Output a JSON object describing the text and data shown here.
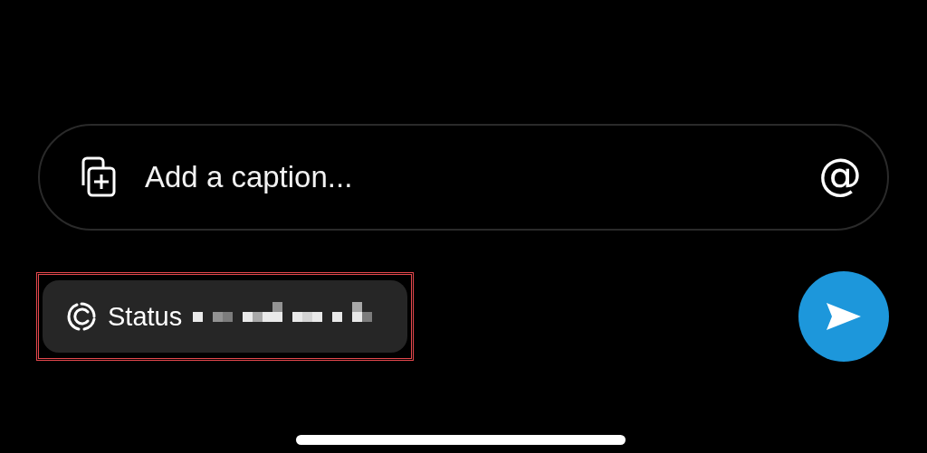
{
  "caption_field": {
    "placeholder": "Add a caption..."
  },
  "mention_button": {
    "label": "@"
  },
  "status_chip": {
    "label": "Status",
    "highlighted": true
  },
  "send_button": {
    "disabled": false
  }
}
